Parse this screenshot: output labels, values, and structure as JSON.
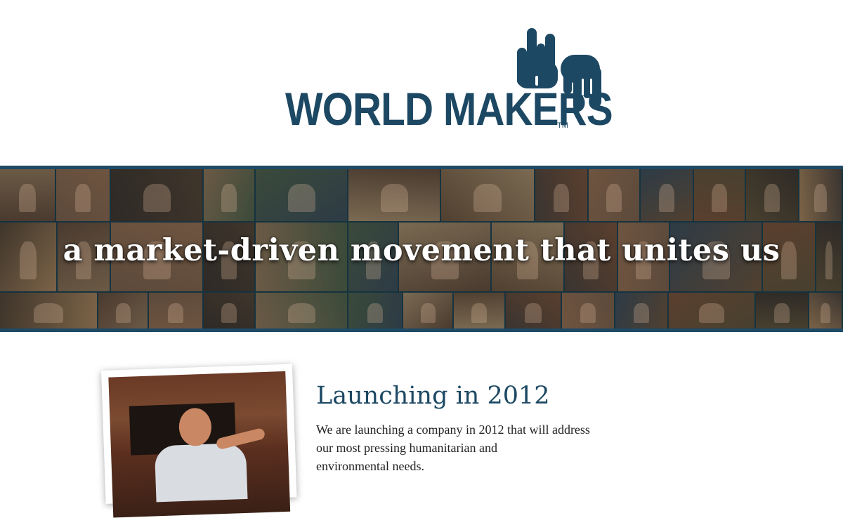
{
  "header": {
    "logo_text": "WORLD MAKERS",
    "trademark": "TM",
    "logo_icon": "hand-icon",
    "brand_color": "#1c4863"
  },
  "banner": {
    "tagline": "a market-driven movement that unites us",
    "border_color": "#1e4a66"
  },
  "content": {
    "heading": "Launching in 2012",
    "body_lines": [
      "We are launching a company in 2012 that will address",
      "our most pressing humanitarian and",
      "environmental needs."
    ]
  }
}
